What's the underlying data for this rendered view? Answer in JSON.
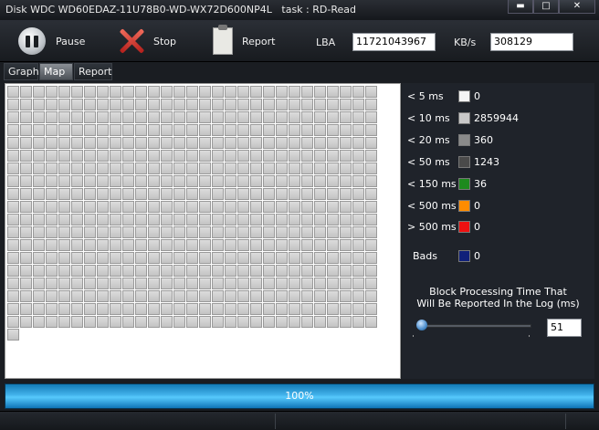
{
  "window": {
    "title": "Disk WDC WD60EDAZ-11U78B0-WD-WX72D600NP4L   task : RD-Read",
    "controls": {
      "minimize": "▬",
      "maximize": "□",
      "close": "✕"
    }
  },
  "toolbar": {
    "pause_label": "Pause",
    "stop_label": "Stop",
    "report_label": "Report",
    "lba_label": "LBA",
    "lba_value": "11721043967",
    "kbs_label": "KB/s",
    "kbs_value": "308129"
  },
  "tabs": [
    {
      "label": "Graph",
      "active": false
    },
    {
      "label": "Map",
      "active": true
    },
    {
      "label": "Report",
      "active": false
    }
  ],
  "map": {
    "columns": 29,
    "full_rows": 19,
    "last_row_blocks": 1,
    "block_color": "#d0d0d0"
  },
  "legend": [
    {
      "label": "< 5 ms",
      "color": "#f4f4f4",
      "count": "0"
    },
    {
      "label": "< 10 ms",
      "color": "#c8c8c8",
      "count": "2859944"
    },
    {
      "label": "< 20 ms",
      "color": "#8a8a8a",
      "count": "360"
    },
    {
      "label": "< 50 ms",
      "color": "#4a4a4a",
      "count": "1243"
    },
    {
      "label": "< 150 ms",
      "color": "#1e8a1e",
      "count": "36"
    },
    {
      "label": "< 500 ms",
      "color": "#ff8c00",
      "count": "0"
    },
    {
      "label": "> 500 ms",
      "color": "#ee1111",
      "count": "0"
    },
    {
      "label": "Bads",
      "color": "#10207a",
      "count": "0"
    }
  ],
  "threshold": {
    "line1": "Block Processing Time That",
    "line2": "Will Be Reported In the Log (ms)",
    "value": "51",
    "slider_fraction": 0.05
  },
  "progress": {
    "text": "100%",
    "value": 1.0
  }
}
